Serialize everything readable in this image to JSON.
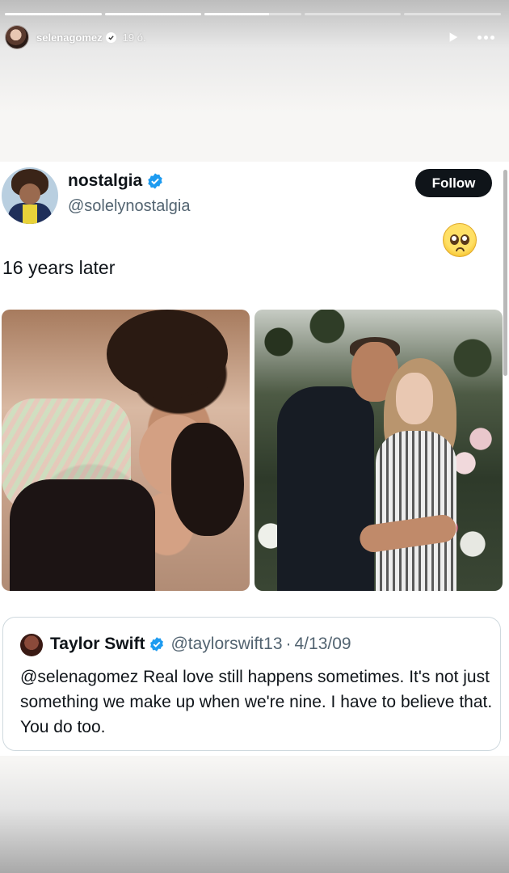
{
  "story": {
    "progress": [
      1.0,
      1.0,
      0.67,
      0.0,
      0.0
    ],
    "username": "selenagomez",
    "time": "19 ó.",
    "icons": {
      "avatar": "profile-photo",
      "verified": "verified-badge-icon",
      "play": "play-icon",
      "more": "more-horizontal-icon"
    }
  },
  "tweet": {
    "author_name": "nostalgia",
    "author_handle": "@solelynostalgia",
    "follow_label": "Follow",
    "emoji": "pleading-face-emoji",
    "text": "16 years later",
    "photos": [
      "couple-photo-left",
      "couple-photo-right"
    ],
    "quote": {
      "name": "Taylor Swift",
      "handle": "@taylorswift13",
      "separator": "·",
      "date": "4/13/09",
      "text": "@selenagomez Real love still happens sometimes. It's not just something we make up when we're nine. I have to believe that. You do too."
    }
  },
  "colors": {
    "verified_blue": "#1d9bf0",
    "follow_bg": "#0f1419",
    "text_primary": "#0f1419",
    "text_secondary": "#536471"
  }
}
